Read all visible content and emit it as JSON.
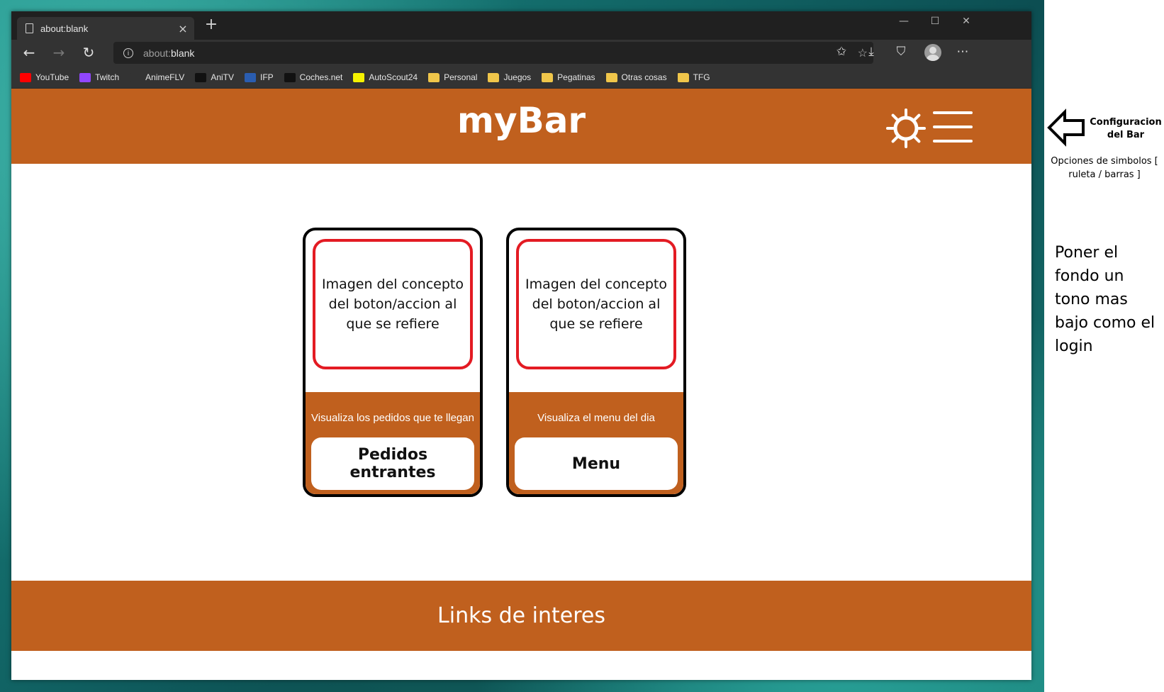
{
  "browser": {
    "tab_title": "about:blank",
    "url_prefix": "about:",
    "url_rest": "blank",
    "bookmarks": [
      {
        "label": "YouTube",
        "icon": "youtube-icon",
        "color": "#ff0000"
      },
      {
        "label": "Twitch",
        "icon": "twitch-icon",
        "color": "#9146ff"
      },
      {
        "label": "AnimeFLV",
        "icon": "animeflv-icon",
        "color": "#333333"
      },
      {
        "label": "AniTV",
        "icon": "anitv-icon",
        "color": "#111111"
      },
      {
        "label": "IFP",
        "icon": "ifp-icon",
        "color": "#2a5db0"
      },
      {
        "label": "Coches.net",
        "icon": "cochesnet-icon",
        "color": "#111111"
      },
      {
        "label": "AutoScout24",
        "icon": "autoscout-icon",
        "color": "#f5f200"
      },
      {
        "label": "Personal",
        "icon": "folder-icon",
        "color": "#f0c64a"
      },
      {
        "label": "Juegos",
        "icon": "folder-icon",
        "color": "#f0c64a"
      },
      {
        "label": "Pegatinas",
        "icon": "folder-icon",
        "color": "#f0c64a"
      },
      {
        "label": "Otras cosas",
        "icon": "folder-icon",
        "color": "#f0c64a"
      },
      {
        "label": "TFG",
        "icon": "folder-icon",
        "color": "#f0c64a"
      }
    ]
  },
  "app": {
    "brand": "myBar",
    "accent_color": "#c0601e",
    "cards": [
      {
        "image_text": "Imagen del concepto del boton/accion al que se refiere",
        "description": "Visualiza los pedidos que te llegan",
        "button_label": "Pedidos entrantes"
      },
      {
        "image_text": "Imagen del concepto del boton/accion al que se refiere",
        "description": "Visualiza el menu del dia",
        "button_label": "Menu"
      }
    ],
    "footer_text": "Links de interes"
  },
  "annotations": {
    "config_label": "Configuracion del Bar",
    "options_label": "Opciones de simbolos [ ruleta / barras ]",
    "note": "Poner el fondo un tono mas bajo como el login"
  }
}
